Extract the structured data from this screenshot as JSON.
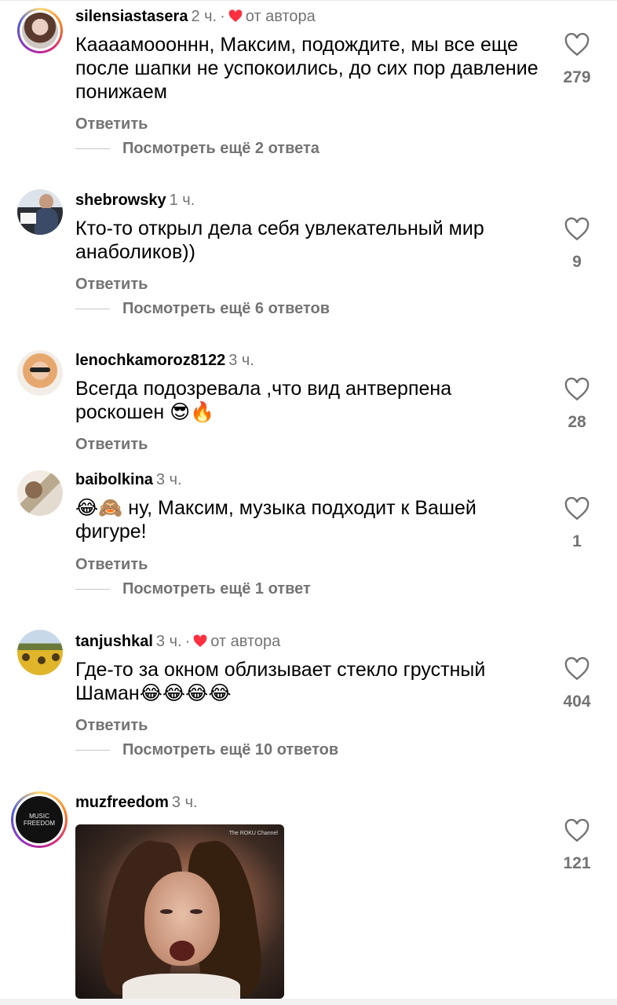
{
  "comments": [
    {
      "username": "silensiastasera",
      "time": "2 ч.",
      "author_liked": true,
      "author_label": "от автора",
      "text": "Кааaамоооннн, Максим, подождите, мы все еще после шапки не успокоились, до сих пор давление понижаем",
      "reply_label": "Ответить",
      "more_replies": "Посмотреть ещё 2 ответа",
      "likes": "279"
    },
    {
      "username": "shebrowsky",
      "time": "1 ч.",
      "author_liked": false,
      "text": "Кто-то открыл дела себя увлекательный мир анаболиков))",
      "reply_label": "Ответить",
      "more_replies": "Посмотреть ещё 6 ответов",
      "likes": "9"
    },
    {
      "username": "lenochkamoroz8122",
      "time": "3 ч.",
      "author_liked": false,
      "text": "Всегда подозревала ,что вид антверпена роскошен",
      "emoji": "😎🔥",
      "reply_label": "Ответить",
      "likes": "28"
    },
    {
      "username": "baibolkina",
      "time": "3 ч.",
      "author_liked": false,
      "emoji_prefix": "😂🙈",
      "text": "ну, Максим, музыка подходит к Вашей фигуре!",
      "reply_label": "Ответить",
      "more_replies": "Посмотреть ещё 1 ответ",
      "likes": "1"
    },
    {
      "username": "tanjushkal",
      "time": "3 ч.",
      "author_liked": true,
      "author_label": "от автора",
      "text": "Где-то за окном облизывает стекло грустный Шаман",
      "emoji": "😂😂😂😂",
      "reply_label": "Ответить",
      "more_replies": "Посмотреть ещё 10 ответов",
      "likes": "404"
    },
    {
      "username": "muzfreedom",
      "time": "3 ч.",
      "author_liked": false,
      "avatar_text": "MUSIC FREEDOM",
      "gif_watermark": "The ROKU Channel",
      "likes": "121"
    }
  ],
  "icons": {
    "heart_outline": "heart-icon",
    "heart_filled_color": "#ff3040"
  }
}
